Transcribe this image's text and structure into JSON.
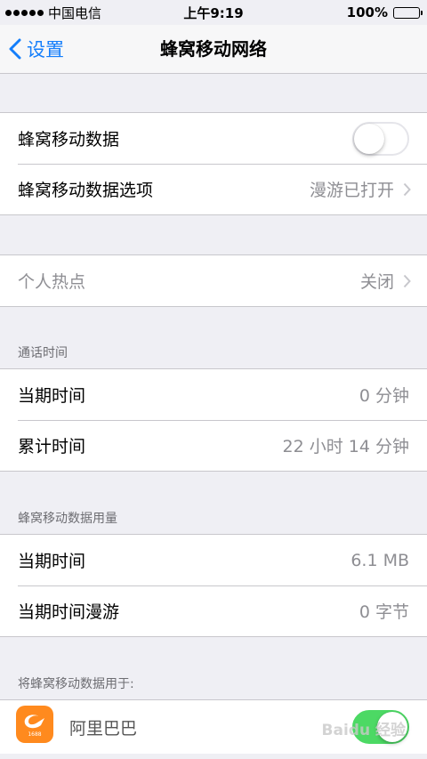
{
  "status_bar": {
    "carrier": "中国电信",
    "time": "上午9:19",
    "battery_percent": "100%"
  },
  "nav": {
    "back_label": "设置",
    "title": "蜂窝移动网络"
  },
  "group1": {
    "cellular_data_label": "蜂窝移动数据",
    "cellular_data_on": false,
    "options_label": "蜂窝移动数据选项",
    "options_value": "漫游已打开"
  },
  "group2": {
    "hotspot_label": "个人热点",
    "hotspot_value": "关闭"
  },
  "call_time": {
    "header": "通话时间",
    "current_label": "当期时间",
    "current_value": "0 分钟",
    "total_label": "累计时间",
    "total_value": "22 小时 14 分钟"
  },
  "usage": {
    "header": "蜂窝移动数据用量",
    "current_label": "当期时间",
    "current_value": "6.1 MB",
    "roaming_label": "当期时间漫游",
    "roaming_value": "0 字节"
  },
  "apps": {
    "header": "将蜂窝移动数据用于:",
    "items": [
      {
        "name": "阿里巴巴",
        "icon": "alibaba-app-icon",
        "enabled": true
      }
    ]
  },
  "watermark": "Baidu 经验",
  "colors": {
    "accent": "#147efb",
    "toggle_on": "#4cd964",
    "background": "#efeff4",
    "app_icon": "#ff8a1e"
  }
}
